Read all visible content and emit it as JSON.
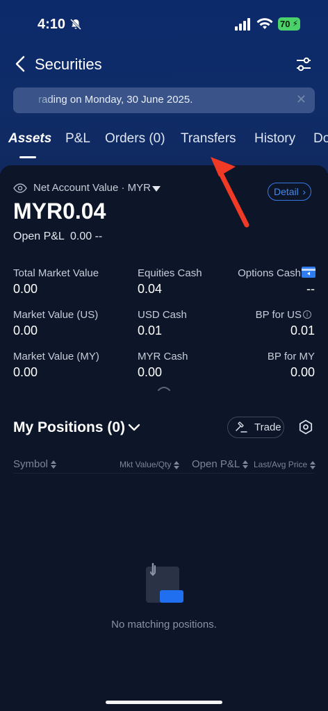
{
  "status_bar": {
    "time": "4:10",
    "battery": "70"
  },
  "nav": {
    "title": "Securities"
  },
  "banner": {
    "text": "rading on Monday, 30 June 2025."
  },
  "tabs": [
    {
      "label": "Assets"
    },
    {
      "label": "P&L"
    },
    {
      "label": "Orders (0)"
    },
    {
      "label": "Transfers"
    },
    {
      "label": "History"
    },
    {
      "label": "Do"
    }
  ],
  "account": {
    "net_value_label": "Net Account Value · MYR",
    "detail_label": "Detail",
    "net_value": "MYR0.04",
    "open_pl_label": "Open P&L",
    "open_pl_value": "0.00 --"
  },
  "metrics": [
    {
      "label": "Total Market Value",
      "value": "0.00"
    },
    {
      "label": "Equities Cash",
      "value": "0.04"
    },
    {
      "label": "Options Cash",
      "value": "--"
    },
    {
      "label": "Market Value (US)",
      "value": "0.00"
    },
    {
      "label": "USD Cash",
      "value": "0.01"
    },
    {
      "label": "BP for US",
      "value": "0.01"
    },
    {
      "label": "Market Value (MY)",
      "value": "0.00"
    },
    {
      "label": "MYR Cash",
      "value": "0.00"
    },
    {
      "label": "BP for MY",
      "value": "0.00"
    }
  ],
  "positions": {
    "title": "My Positions (0)",
    "trade_label": "Trade",
    "columns": [
      "Symbol",
      "Mkt Value/Qty",
      "Open P&L",
      "Last/Avg Price"
    ],
    "empty_text": "No matching positions."
  },
  "colors": {
    "header_bg": "#0f2c68",
    "accent_blue": "#3f8af0",
    "annotation_arrow": "#f03a25"
  }
}
